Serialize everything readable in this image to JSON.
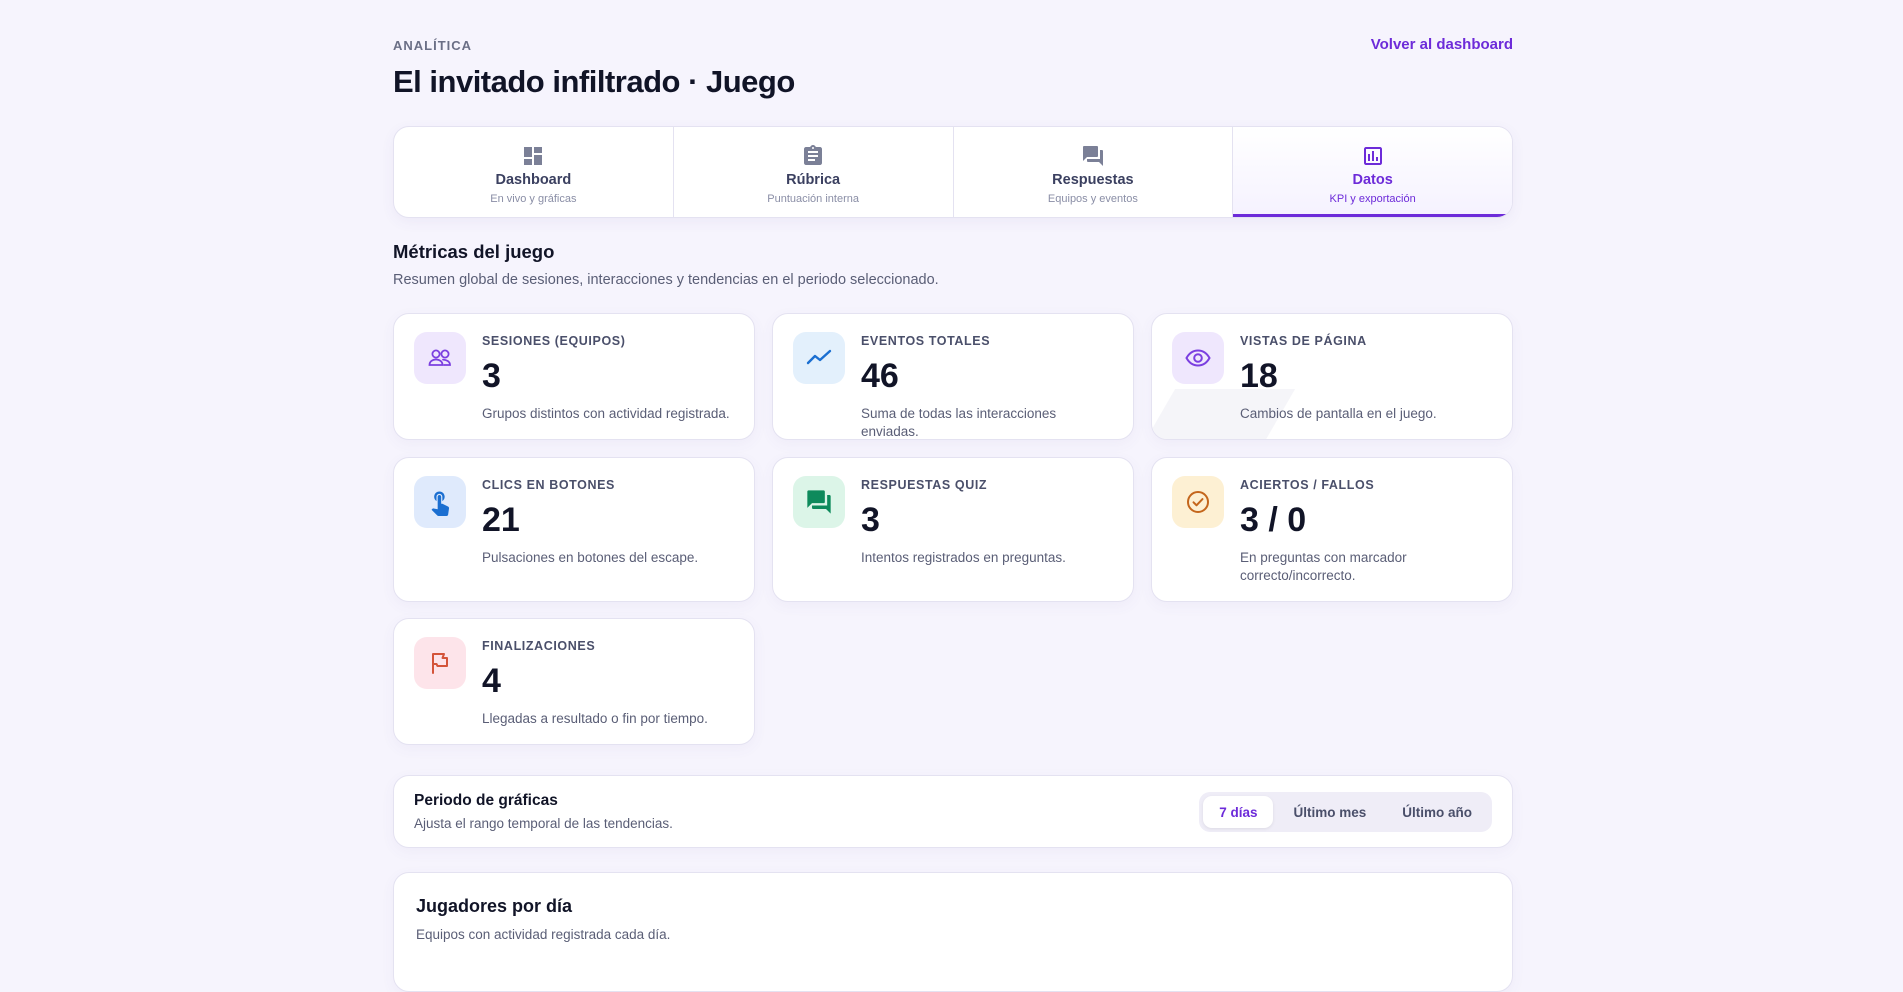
{
  "header": {
    "eyebrow": "ANALÍTICA",
    "title": "El invitado infiltrado · Juego",
    "back_link": "Volver al dashboard"
  },
  "tabs": [
    {
      "label": "Dashboard",
      "sub": "En vivo y gráficas",
      "icon": "dashboard-icon",
      "active": false
    },
    {
      "label": "Rúbrica",
      "sub": "Puntuación interna",
      "icon": "clipboard-icon",
      "active": false
    },
    {
      "label": "Respuestas",
      "sub": "Equipos y eventos",
      "icon": "chat-icon",
      "active": false
    },
    {
      "label": "Datos",
      "sub": "KPI y exportación",
      "icon": "bar-chart-icon",
      "active": true
    }
  ],
  "section": {
    "title": "Métricas del juego",
    "subtitle": "Resumen global de sesiones, interacciones y tendencias en el periodo seleccionado."
  },
  "metrics": [
    {
      "label": "SESIONES (EQUIPOS)",
      "value": "3",
      "desc": "Grupos distintos con actividad registrada.",
      "icon": "users-icon",
      "icon_color": "#7b3fe0",
      "icon_bg": "#efe7fd"
    },
    {
      "label": "EVENTOS TOTALES",
      "value": "46",
      "desc": "Suma de todas las interacciones enviadas.",
      "icon": "trend-line-icon",
      "icon_color": "#1b6fd1",
      "icon_bg": "#e3f0fc"
    },
    {
      "label": "VISTAS DE PÁGINA",
      "value": "18",
      "desc": "Cambios de pantalla en el juego.",
      "icon": "eye-icon",
      "icon_color": "#7b3fe0",
      "icon_bg": "#efe7fd"
    },
    {
      "label": "CLICS EN BOTONES",
      "value": "21",
      "desc": "Pulsaciones en botones del escape.",
      "icon": "touch-icon",
      "icon_color": "#1b6fd1",
      "icon_bg": "#dfeafc"
    },
    {
      "label": "RESPUESTAS QUIZ",
      "value": "3",
      "desc": "Intentos registrados en preguntas.",
      "icon": "forum-icon",
      "icon_color": "#0e8a5c",
      "icon_bg": "#dcf5e8"
    },
    {
      "label": "ACIERTOS / FALLOS",
      "value": "3 / 0",
      "desc": "En preguntas con marcador correcto/incorrecto.",
      "icon": "check-circle-icon",
      "icon_color": "#c4661c",
      "icon_bg": "#fdf0d3"
    },
    {
      "label": "FINALIZACIONES",
      "value": "4",
      "desc": "Llegadas a resultado o fin por tiempo.",
      "icon": "flag-icon",
      "icon_color": "#d4543a",
      "icon_bg": "#fde4ea"
    }
  ],
  "period": {
    "title": "Periodo de gráficas",
    "subtitle": "Ajusta el rango temporal de las tendencias.",
    "options": [
      "7 días",
      "Último mes",
      "Último año"
    ],
    "selected": "7 días"
  },
  "chart_card": {
    "title": "Jugadores por día",
    "subtitle": "Equipos con actividad registrada cada día."
  },
  "colors": {
    "accent": "#6d2bd9",
    "background": "#f6f4fd"
  }
}
